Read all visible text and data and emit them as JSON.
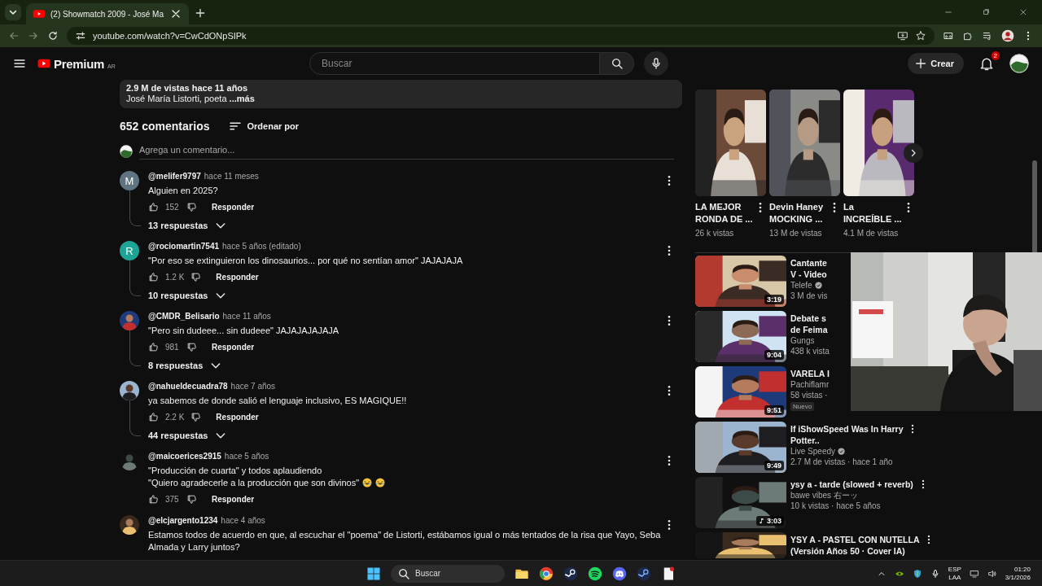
{
  "browser": {
    "tab_title": "(2) Showmatch 2009 - José Ma",
    "url": "youtube.com/watch?v=CwCdONpSIPk"
  },
  "masthead": {
    "logo": "Premium",
    "region": "AR",
    "search_placeholder": "Buscar",
    "create": "Crear",
    "notifications": "2"
  },
  "description": {
    "stats": "2.9 M de vistas  hace 11 años",
    "text": "José María Listorti, poeta",
    "more": "...más"
  },
  "comments_header": {
    "count": "652 comentarios",
    "sort": "Ordenar por"
  },
  "comment_box": {
    "placeholder": "Agrega un comentario..."
  },
  "comments": [
    {
      "avatar": {
        "kind": "letter",
        "letter": "M",
        "color": "#5f7480"
      },
      "author": "@melifer9797",
      "time": "hace 11 meses",
      "text": "Alguien en 2025?",
      "likes": "152",
      "reply_label": "Responder",
      "replies": "13 respuestas"
    },
    {
      "avatar": {
        "kind": "letter",
        "letter": "R",
        "color": "#1fa397"
      },
      "author": "@rociomartin7541",
      "time": "hace 5 años (editado)",
      "text": "\"Por eso se extinguieron los dinosaurios... por qué no sentían amor\" JAJAJAJA",
      "likes": "1.2 K",
      "reply_label": "Responder",
      "replies": "10 respuestas"
    },
    {
      "avatar": {
        "kind": "picture"
      },
      "author": "@CMDR_Belisario",
      "time": "hace 11 años",
      "text": "\"Pero sin dudeee... sin dudeee\" JAJAJAJAJAJA",
      "likes": "981",
      "reply_label": "Responder",
      "replies": "8 respuestas"
    },
    {
      "avatar": {
        "kind": "picture"
      },
      "author": "@nahueldecuadra78",
      "time": "hace 7 años",
      "text": "ya sabemos de donde salió el lenguaje inclusivo, ES MAGIQUE!!",
      "likes": "2.2 K",
      "reply_label": "Responder",
      "replies": "44 respuestas"
    },
    {
      "avatar": {
        "kind": "picture"
      },
      "author": "@maicoerices2915",
      "time": "hace 5 años",
      "text": "\"Producción de cuarta\" y todos aplaudiendo\n\"Quiero agradecerle a la producción que son divinos\"",
      "emojis": [
        {
          "kind": "laugh"
        },
        {
          "kind": "laugh"
        }
      ],
      "likes": "375",
      "reply_label": "Responder"
    },
    {
      "avatar": {
        "kind": "picture"
      },
      "author": "@elcjargento1234",
      "time": "hace 4 años",
      "text": "Estamos todos de acuerdo en que, al escuchar el \"poema\" de Listorti, estábamos igual o más tentados de la risa que Yayo, Seba Almada y Larry juntos?"
    }
  ],
  "shorts": [
    {
      "title_lines": [
        "LA MEJOR",
        "RONDA DE ..."
      ],
      "views": "26 k vistas"
    },
    {
      "title_lines": [
        "Devin Haney",
        "MOCKING ..."
      ],
      "views": "13 M de vistas"
    },
    {
      "title_lines": [
        "La",
        "INCREÍBLE ..."
      ],
      "views": "4.1 M de vistas"
    }
  ],
  "videos": [
    {
      "title_lines": [
        "Cantante",
        "V - Video"
      ],
      "channel": "Telefe",
      "verified": true,
      "meta": "3 M de vis",
      "duration": "3:19",
      "menu": false
    },
    {
      "title_lines": [
        "Debate s",
        "de Feima"
      ],
      "channel": "Gungs",
      "verified": false,
      "meta": "438 k vista",
      "duration": "9:04",
      "menu": false
    },
    {
      "title_lines": [
        "VARELA I"
      ],
      "channel": "Pachiflamr",
      "verified": false,
      "meta": "58 vistas ·",
      "badge": "Nuevo",
      "duration": "9:51",
      "menu": false
    },
    {
      "title_lines": [
        "If iShowSpeed Was In Harry",
        "Potter.."
      ],
      "channel": "Live Speedy",
      "verified": true,
      "meta": "2.7 M de vistas · hace 1 año",
      "duration": "9:49",
      "menu": true
    },
    {
      "title_lines": [
        "ysy a - tarde (slowed + reverb)"
      ],
      "channel": "bawe vibes 右ーッ",
      "verified": false,
      "meta": "10 k vistas · hace 5 años",
      "duration": "3:03",
      "music": true,
      "menu": true
    },
    {
      "title_lines": [
        "YSY A - PASTEL CON NUTELLA",
        "(Versión Años 50 · Cover IA)"
      ],
      "verified": false,
      "menu": true
    }
  ],
  "taskbar": {
    "search": "Buscar",
    "lang": "ESP",
    "layout": "LAA",
    "time": "01:20",
    "date": "3/1/2026"
  }
}
